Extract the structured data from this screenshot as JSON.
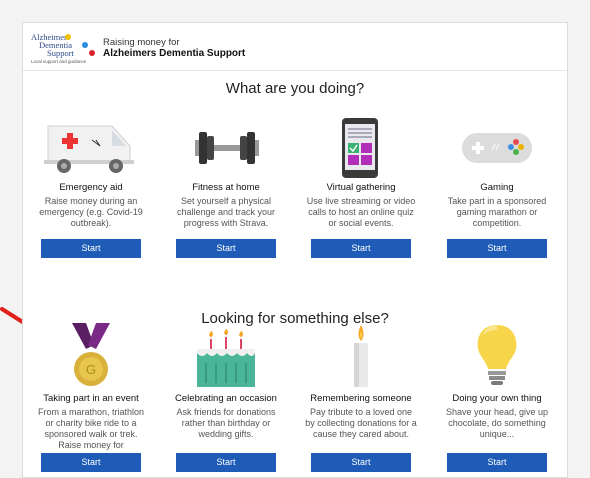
{
  "header": {
    "logo": {
      "line1": "Alzheimers",
      "line2": "Dementia",
      "line3": "Support",
      "tagline": "Local support and guidance"
    },
    "raising_text": "Raising money for",
    "charity_name": "Alzheimers Dementia Support"
  },
  "section1": {
    "title": "What are you doing?",
    "tiles": [
      {
        "title": "Emergency aid",
        "description": "Raise money during an emergency (e.g. Covid-19 outbreak).",
        "button": "Start",
        "icon": "ambulance-icon"
      },
      {
        "title": "Fitness at home",
        "description": "Set yourself a physical challenge and track your progress with Strava.",
        "button": "Start",
        "icon": "dumbbell-icon"
      },
      {
        "title": "Virtual gathering",
        "description": "Use live streaming or video calls to host an online quiz or social events.",
        "button": "Start",
        "icon": "phone-icon"
      },
      {
        "title": "Gaming",
        "description": "Take part in a sponsored gaming marathon or competition.",
        "button": "Start",
        "icon": "gamepad-icon"
      }
    ]
  },
  "section2": {
    "title": "Looking for something else?",
    "tiles": [
      {
        "title": "Taking part in an event",
        "description": "From a marathon, triathlon or charity bike ride to a sponsored walk or trek. Raise money for",
        "button": "Start",
        "icon": "medal-icon"
      },
      {
        "title": "Celebrating an occasion",
        "description": "Ask friends for donations rather than birthday or wedding gifts.",
        "button": "Start",
        "icon": "cake-icon"
      },
      {
        "title": "Remembering someone",
        "description": "Pay tribute to a loved one by collecting donations for a cause they cared about.",
        "button": "Start",
        "icon": "candle-icon"
      },
      {
        "title": "Doing your own thing",
        "description": "Shave your head, give up chocolate, do something unique...",
        "button": "Start",
        "icon": "lightbulb-icon"
      }
    ]
  },
  "colors": {
    "button_blue": "#1f5cb8",
    "arrow_red": "#e0201b",
    "logo_blue": "#2c4a8a"
  }
}
